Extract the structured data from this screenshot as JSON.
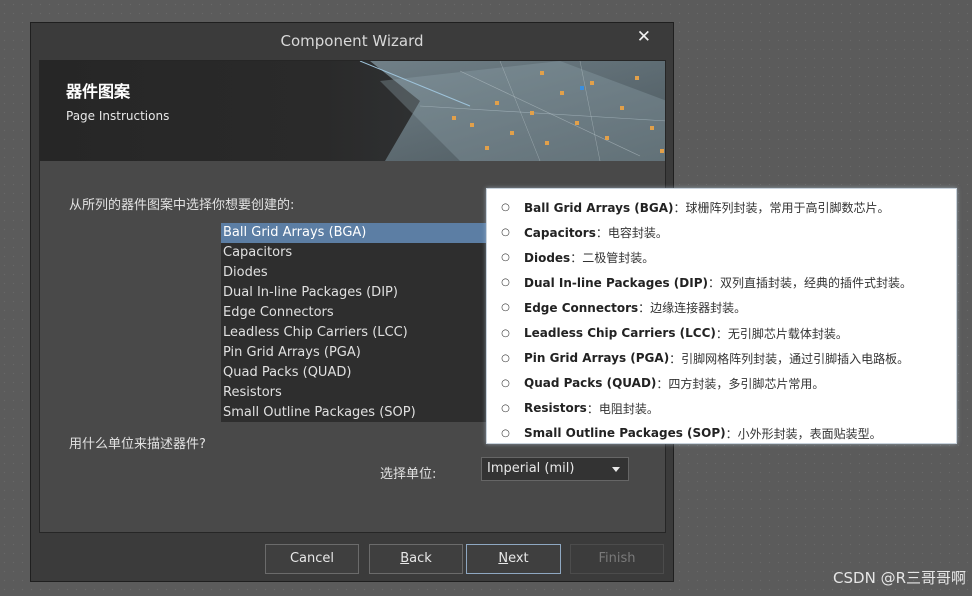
{
  "dialog": {
    "title": "Component Wizard",
    "close_glyph": "✕",
    "header": {
      "title": "器件图案",
      "subtitle": "Page Instructions"
    },
    "prompt_pattern": "从所列的器件图案中选择你想要创建的:",
    "patterns": [
      {
        "label": "Ball Grid Arrays (BGA)",
        "selected": true
      },
      {
        "label": "Capacitors",
        "selected": false
      },
      {
        "label": "Diodes",
        "selected": false
      },
      {
        "label": "Dual In-line Packages (DIP)",
        "selected": false
      },
      {
        "label": "Edge Connectors",
        "selected": false
      },
      {
        "label": "Leadless Chip Carriers (LCC)",
        "selected": false
      },
      {
        "label": "Pin Grid Arrays (PGA)",
        "selected": false
      },
      {
        "label": "Quad Packs (QUAD)",
        "selected": false
      },
      {
        "label": "Resistors",
        "selected": false
      },
      {
        "label": "Small Outline Packages (SOP)",
        "selected": false
      }
    ],
    "prompt_unit": "用什么单位来描述器件?",
    "unit_label": "选择单位:",
    "unit_value": "Imperial (mil)",
    "buttons": {
      "cancel": "Cancel",
      "back_mnemonic": "B",
      "back_rest": "ack",
      "next_mnemonic": "N",
      "next_rest": "ext",
      "finish": "Finish"
    }
  },
  "tooltip": {
    "items": [
      {
        "term": "Ball Grid Arrays (BGA)",
        "desc": "：球栅阵列封装，常用于高引脚数芯片。"
      },
      {
        "term": "Capacitors",
        "desc": "：电容封装。"
      },
      {
        "term": "Diodes",
        "desc": "：二极管封装。"
      },
      {
        "term": "Dual In-line Packages (DIP)",
        "desc": "：双列直插封装，经典的插件式封装。"
      },
      {
        "term": "Edge Connectors",
        "desc": "：边缘连接器封装。"
      },
      {
        "term": "Leadless Chip Carriers (LCC)",
        "desc": "：无引脚芯片载体封装。"
      },
      {
        "term": "Pin Grid Arrays (PGA)",
        "desc": "：引脚网格阵列封装，通过引脚插入电路板。"
      },
      {
        "term": "Quad Packs (QUAD)",
        "desc": "：四方封装，多引脚芯片常用。"
      },
      {
        "term": "Resistors",
        "desc": "：电阻封装。"
      },
      {
        "term": "Small Outline Packages (SOP)",
        "desc": "：小外形封装，表面贴装型。"
      }
    ]
  },
  "watermark": "CSDN @R三哥哥啊",
  "colors": {
    "selection": "#5c7ea4",
    "dialog_bg": "#3b3b3b",
    "panel_bg": "#494949",
    "list_bg": "#2e2e2e",
    "desktop_bg": "#5b5b5b"
  }
}
